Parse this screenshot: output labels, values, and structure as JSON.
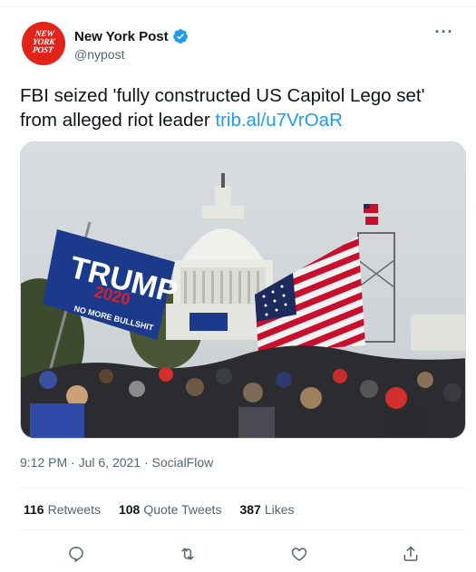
{
  "tweet": {
    "author": {
      "display_name": "New York Post",
      "handle": "@nypost",
      "verified": true,
      "avatar_text": [
        "NEW",
        "YORK",
        "POST"
      ]
    },
    "more_label": "···",
    "text": "FBI seized 'fully constructed US Capitol Lego set' from alleged riot leader ",
    "link": "trib.al/u7VrOaR",
    "media": {
      "sign_line1": "TRUMP",
      "sign_line2": "2020",
      "sign_line3": "NO MORE BULLSHIT"
    },
    "time": "9:12 PM",
    "separator": " · ",
    "date": "Jul 6, 2021",
    "source": "SocialFlow",
    "stats": {
      "retweets": "116",
      "retweets_label": "Retweets",
      "quotes": "108",
      "quotes_label": "Quote Tweets",
      "likes": "387",
      "likes_label": "Likes"
    },
    "actions": [
      "reply-icon",
      "retweet-icon",
      "like-icon",
      "share-icon"
    ]
  },
  "colors": {
    "link": "#1d9bf0",
    "secondary_text": "#536471",
    "primary_text": "#0f1419",
    "avatar_bg": "#e2231a",
    "verified": "#1d9bf0",
    "divider": "#eff3f4"
  }
}
